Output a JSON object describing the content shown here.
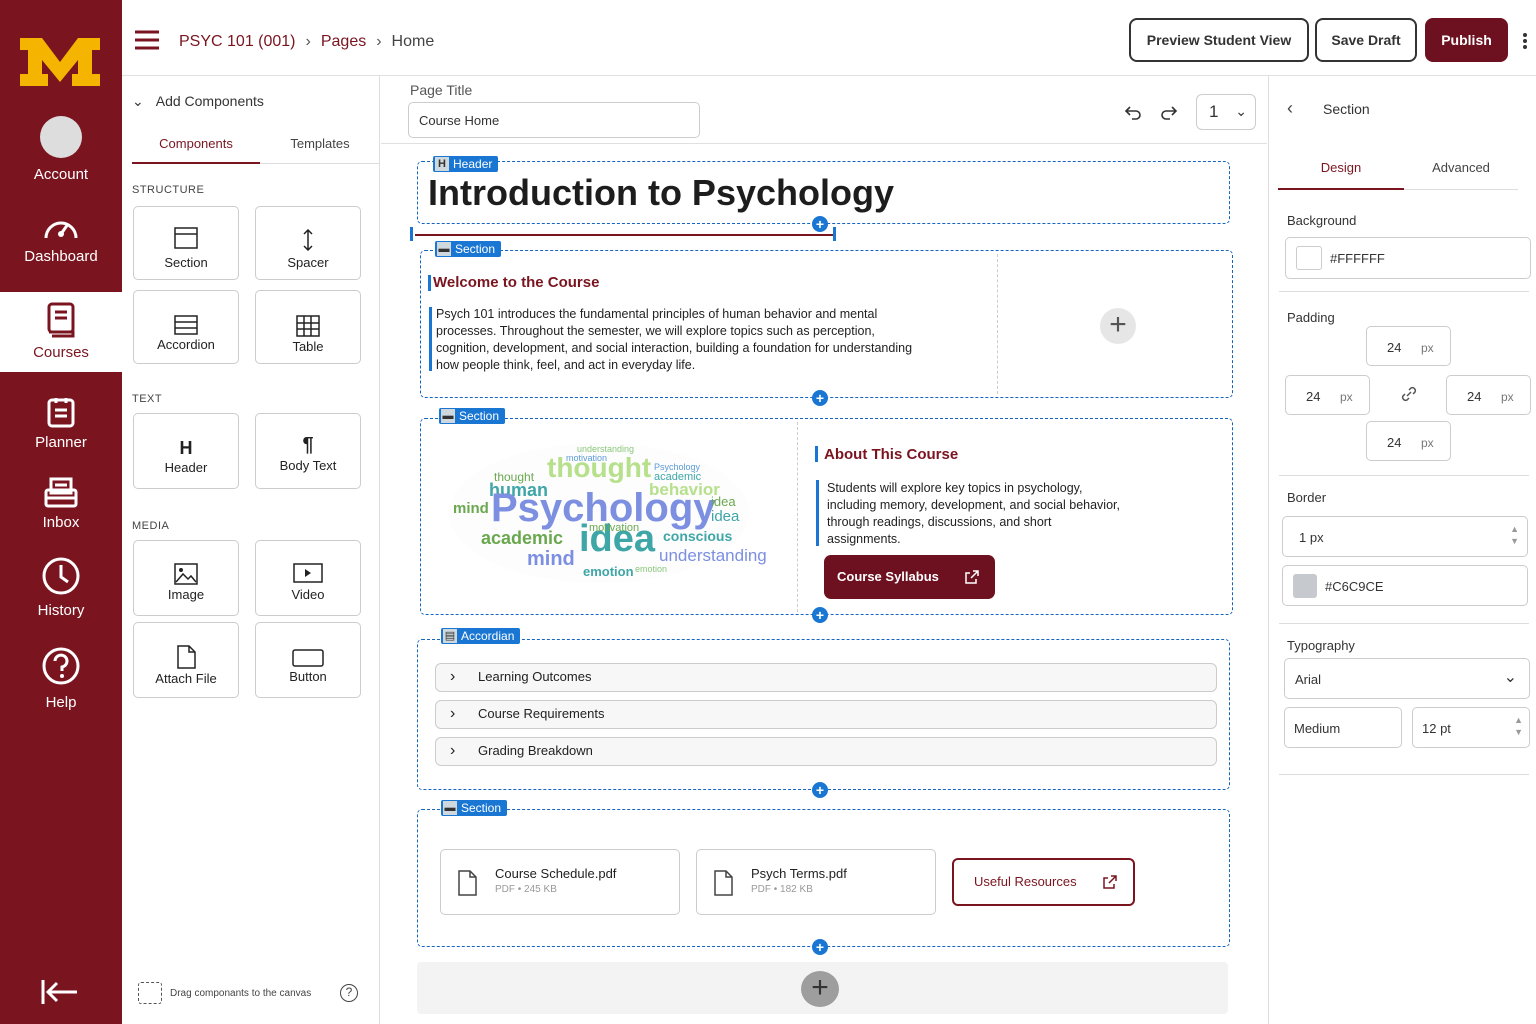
{
  "colors": {
    "brand": "#7a1520",
    "brand_gold": "#f4b400",
    "accent": "#1976d2"
  },
  "nav": {
    "logo": "M",
    "items": [
      {
        "label": "Account",
        "icon": "avatar-icon"
      },
      {
        "label": "Dashboard",
        "icon": "dashboard-gauge-icon"
      },
      {
        "label": "Courses",
        "icon": "book-icon"
      },
      {
        "label": "Planner",
        "icon": "planner-icon"
      },
      {
        "label": "Inbox",
        "icon": "inbox-icon"
      },
      {
        "label": "History",
        "icon": "clock-icon"
      },
      {
        "label": "Help",
        "icon": "help-icon"
      }
    ],
    "collapse_icon": "collapse-left-icon"
  },
  "header": {
    "breadcrumb": [
      "PSYC 101 (001)",
      "Pages",
      "Home"
    ],
    "preview_btn": "Preview Student View",
    "save_btn": "Save Draft",
    "publish_btn": "Publish"
  },
  "components": {
    "title": "Add Components",
    "tabs": [
      "Components",
      "Templates"
    ],
    "structure_label": "STRUCTURE",
    "structure": [
      "Section",
      "Spacer",
      "Accordion",
      "Table"
    ],
    "text_label": "TEXT",
    "text": [
      "Header",
      "Body Text"
    ],
    "media_label": "MEDIA",
    "media": [
      "Image",
      "Video",
      "Attach File",
      "Button"
    ],
    "drag_hint": "Drag componants to the canvas"
  },
  "canvas": {
    "page_title_label": "Page Title",
    "page_title_value": "Course Home",
    "page_select": "1",
    "header_tag": "Header",
    "heading": "Introduction to Psychology",
    "section_tag": "Section",
    "welcome_title": "Welcome to the Course",
    "welcome_body": "Psych 101 introduces the fundamental principles of human behavior and mental processes. Throughout the semester, we will explore topics such as perception, cognition, development, and social interaction, building a foundation for understanding how people think, feel, and act in everyday life.",
    "about_title": "About This Course",
    "about_body": "Students will explore key topics in psychology, including memory, development, and social behavior, through readings, discussions, and short assignments.",
    "syllabus_btn": "Course Syllabus",
    "accordion_tag": "Accordian",
    "accordion_items": [
      "Learning Outcomes",
      "Course Requirements",
      "Grading Breakdown"
    ],
    "files": [
      {
        "name": "Course Schedule.pdf",
        "meta": "PDF • 245 KB"
      },
      {
        "name": "Psych Terms.pdf",
        "meta": "PDF • 182 KB"
      }
    ],
    "resources_btn": "Useful Resources",
    "wordcloud": {
      "big": [
        "Psychology",
        "idea",
        "thought",
        "human",
        "behavior",
        "academic",
        "mind",
        "emotion",
        "conscious"
      ],
      "small": [
        "motivation",
        "understanding",
        "Psychology",
        "academic",
        "idea",
        "thought",
        "mind",
        "conscious",
        "emotion",
        "behavior",
        "human"
      ]
    }
  },
  "props": {
    "title": "Section",
    "tabs": [
      "Design",
      "Advanced"
    ],
    "background_label": "Background",
    "background_value": "#FFFFFF",
    "padding_label": "Padding",
    "padding": {
      "top": "24",
      "left": "24",
      "right": "24",
      "bottom": "24",
      "unit": "px"
    },
    "border_label": "Border",
    "border_width": "1 px",
    "border_color": "#C6C9CE",
    "typography_label": "Typography",
    "font_select": "Arial",
    "weight_value": "Medium",
    "size_value": "12 pt"
  }
}
